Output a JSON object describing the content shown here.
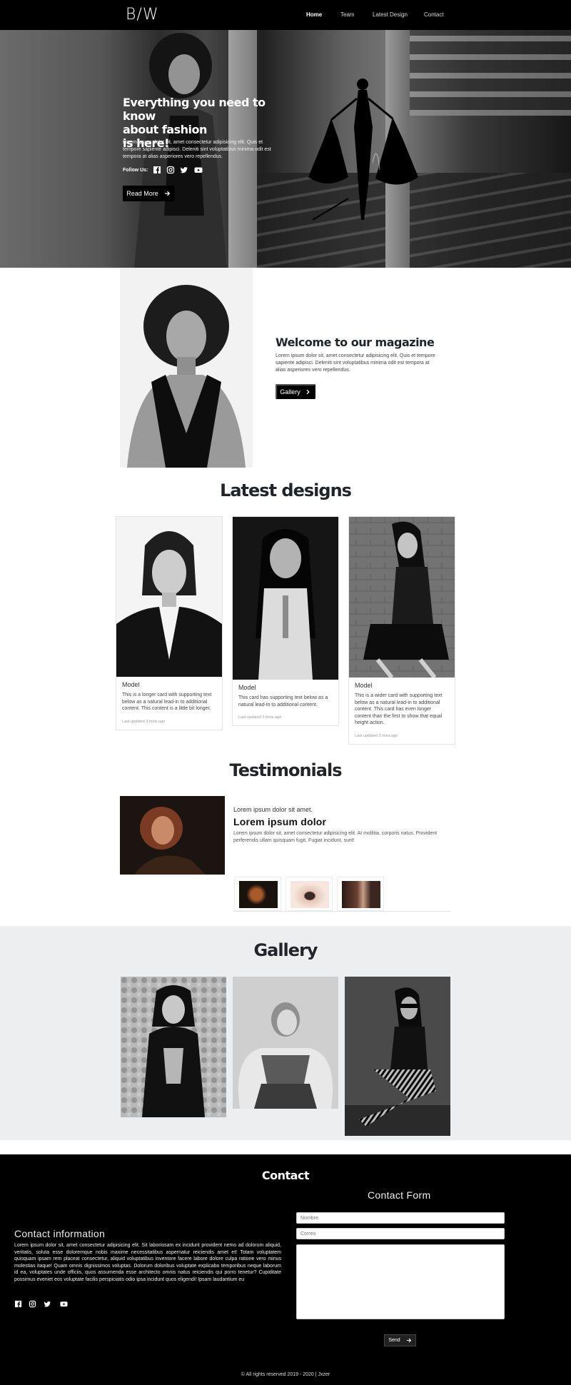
{
  "nav": {
    "brand": "B/W",
    "links": [
      "Home",
      "Team",
      "Latest Design",
      "Contact"
    ]
  },
  "hero": {
    "title_lines": [
      "Everything you need to know",
      "about fashion",
      "is here!"
    ],
    "text": "Lorem ipsum dolor sit, amet consectetur adipisicing elit. Quis et tempore sapiente adipisci. Deleniti sint voluptatibus minima odit est tempora at alias asperiores vero repellendus.",
    "follow_label": "Follow Us:",
    "social_icons": [
      "facebook-icon",
      "instagram-icon",
      "twitter-icon",
      "youtube-icon"
    ],
    "button_label": "Read More"
  },
  "welcome": {
    "title": "Welcome to our magazine",
    "text": "Lorem ipsum dolor sit, amet consectetur adipisicing elit. Quis et tempore sapiente adipisci. Deleniti sint voluptatibus minima odit est tempora at alias asperiores vero repellendus.",
    "button_label": "Gallery"
  },
  "latest": {
    "title": "Latest designs",
    "cards": [
      {
        "title": "Model",
        "text": "This is a longer card with supporting text below as a natural lead-in to additional content. This content is a little bit longer.",
        "meta": "Last updated 3 mins ago"
      },
      {
        "title": "Model",
        "text": "This card has supporting text below as a natural lead-in to additional content.",
        "meta": "Last updated 3 mins ago"
      },
      {
        "title": "Model",
        "text": "This is a wider card with supporting text below as a natural lead-in to additional content. This card has even longer content than the first to show that equal height action.",
        "meta": "Last updated 3 mins ago"
      }
    ]
  },
  "testimonials": {
    "title": "Testimonials",
    "subtitle": "Lorem ipsum dolor sit amet.",
    "name": "Lorem ipsum dolor",
    "text": "Lorem ipsum dolor sit, amet consectetur adipisicing elit. At mollitia, corporis natus. Provident perferendis ullam quisquam fugit. Fugiat incidunt, sunt!"
  },
  "gallery": {
    "title": "Gallery"
  },
  "contact": {
    "title": "Contact",
    "form_title": "Contact Form",
    "info_title": "Contact information",
    "info_text": "Lorem ipsum dolor sit, amet consectetur adipisicing elit. Sit laboriosam ex incidunt provident nemo ad dolorum aliquid, veritatis, soluta esse doloremque nobis maxime necessitatibus aspernatur reiciendis amet et! Totam voluptatem quisquam ipsam rem placeat consectetur, aliquid voluptatibus inventore facere labore dolore culpa ratione vero minus molestias itaque! Quam omnis dignissimos voluptas. Dolorum doloribus voluptate explicabo temporibus neque laborum id ea, voluptates unde officiis, quos assumenda esse architecto omnis natus reiciendis qui porro tenetur? Cupiditate possimus eveniet eos voluptate facilis perspiciatis odio ipsa incidunt quos eligendi! Ipsam laudantium eu",
    "social_icons": [
      "facebook-icon",
      "instagram-icon",
      "twitter-icon",
      "youtube-icon"
    ],
    "name_placeholder": "Nombre",
    "email_placeholder": "Correo",
    "send_label": "Send",
    "copyright": "© All rights reserved 2019 - 2020 | Jxzer"
  }
}
